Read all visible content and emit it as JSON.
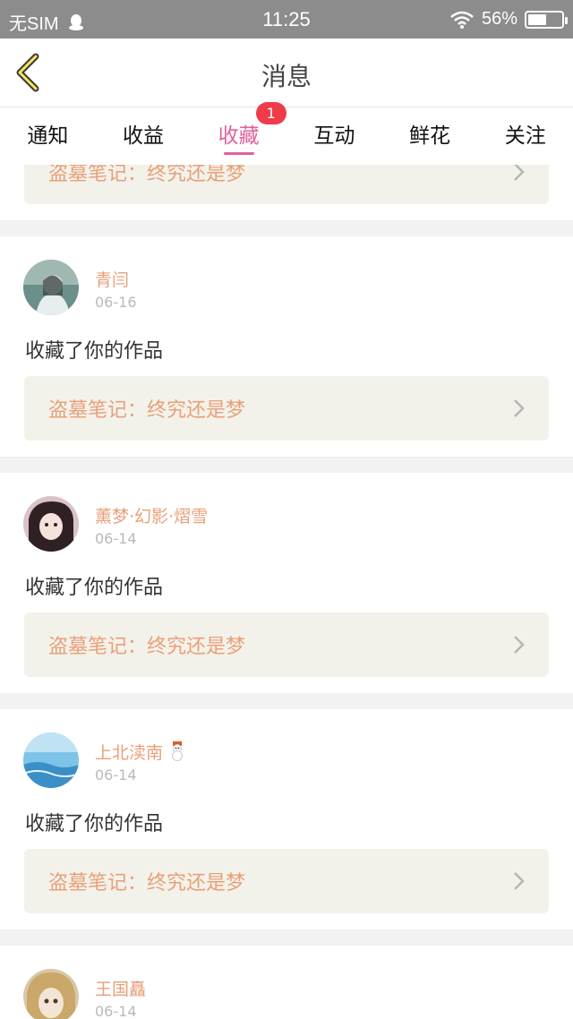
{
  "status_bar": {
    "carrier": "无SIM",
    "time": "11:25",
    "battery_percent": "56%",
    "battery_level": 0.56
  },
  "nav": {
    "title": "消息"
  },
  "tabs": [
    {
      "label": "通知"
    },
    {
      "label": "收益"
    },
    {
      "label": "收藏",
      "badge": "1",
      "active": true
    },
    {
      "label": "互动"
    },
    {
      "label": "鲜花"
    },
    {
      "label": "关注"
    }
  ],
  "partial_top_card": {
    "work_title": "盗墓笔记：终究还是梦"
  },
  "items": [
    {
      "user": "青闫",
      "date": "06-16",
      "action": "收藏了你的作品",
      "work_title": "盗墓笔记：终究还是梦"
    },
    {
      "user": "薰梦·幻影·熠雪",
      "date": "06-14",
      "action": "收藏了你的作品",
      "work_title": "盗墓笔记：终究还是梦"
    },
    {
      "user": "上北渎南",
      "date": "06-14",
      "action": "收藏了你的作品",
      "work_title": "盗墓笔记：终究还是梦"
    },
    {
      "user": "王国矗",
      "date": "06-14"
    }
  ],
  "colors": {
    "accent": "#e0619a",
    "username": "#e8a07a",
    "badge": "#ef3b4a",
    "link_bg": "#f3f2ea"
  }
}
